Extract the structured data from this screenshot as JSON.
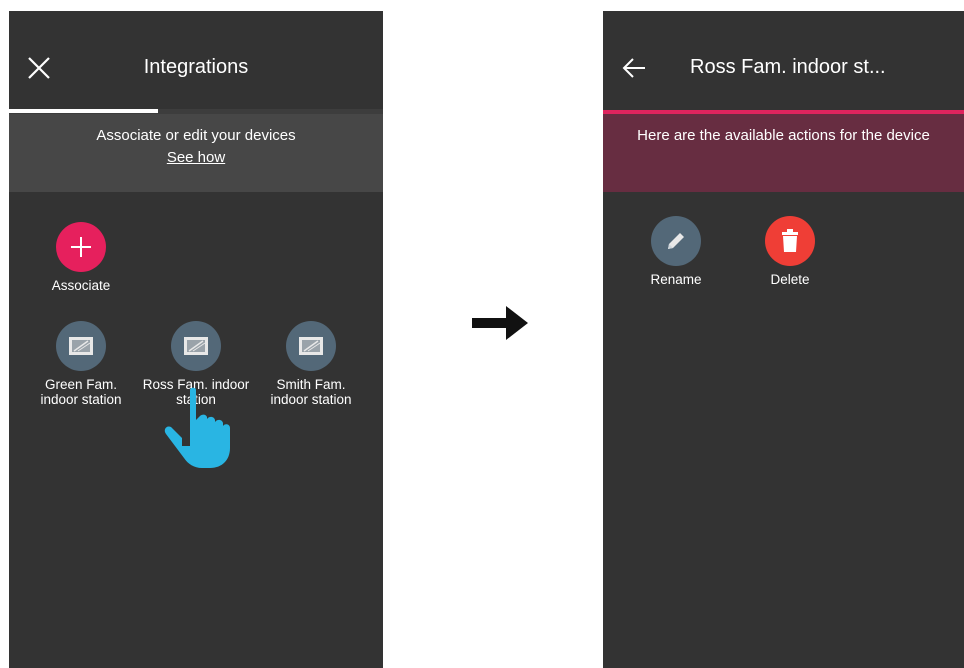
{
  "left_screen": {
    "title": "Integrations",
    "banner_text": "Associate or edit your devices",
    "banner_link": "See how",
    "associate_label": "Associate",
    "devices": [
      {
        "label_line1": "Green Fam.",
        "label_line2": "indoor station"
      },
      {
        "label_line1": "Ross Fam. indoor",
        "label_line2": "station"
      },
      {
        "label_line1": "Smith Fam.",
        "label_line2": "indoor station"
      }
    ]
  },
  "right_screen": {
    "title": "Ross Fam. indoor st...",
    "banner_text": "Here are the available actions for the device",
    "actions": [
      {
        "label": "Rename",
        "icon": "pencil-icon"
      },
      {
        "label": "Delete",
        "icon": "trash-icon"
      }
    ]
  },
  "colors": {
    "screen_bg": "#333333",
    "accent_pink": "#e6205d",
    "accent_bar": "#e0245e",
    "device_icon_bg": "#536878",
    "delete_red": "#ef3e36",
    "hand_cursor": "#29b5e3"
  }
}
